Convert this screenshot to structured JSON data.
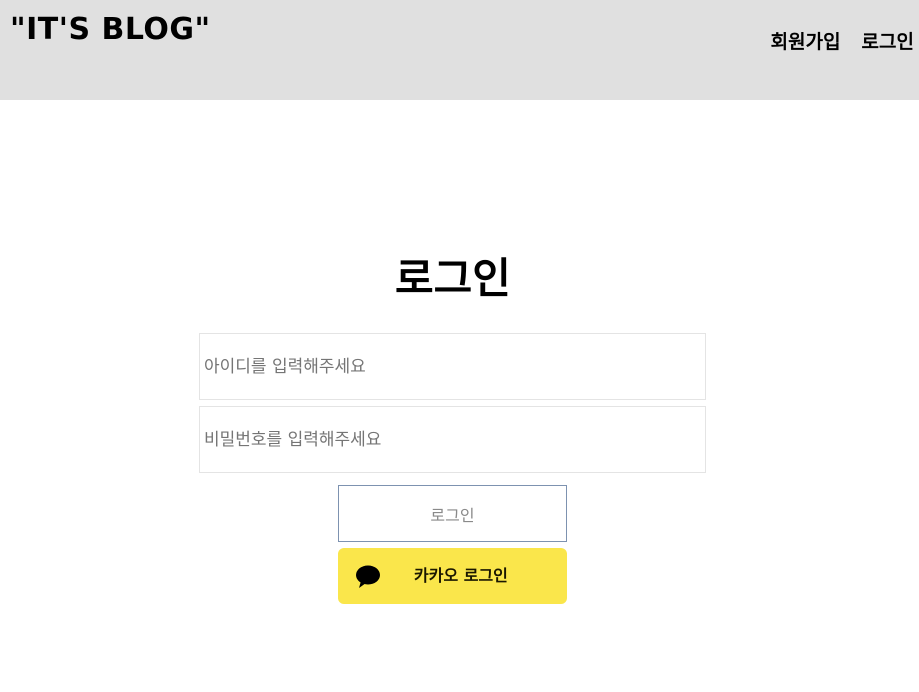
{
  "header": {
    "brand": "\"IT'S BLOG\"",
    "nav": {
      "signup": "회원가입",
      "login": "로그인"
    }
  },
  "main": {
    "title": "로그인",
    "id_placeholder": "아이디를 입력해주세요",
    "password_placeholder": "비밀번호를 입력해주세요",
    "login_button": "로그인",
    "kakao_button": "카카오 로그인",
    "kakao_icon": "speech-bubble-icon"
  },
  "colors": {
    "header_bg": "#e0e0e0",
    "kakao_yellow": "#fae64b",
    "login_border": "#7d92b0"
  }
}
